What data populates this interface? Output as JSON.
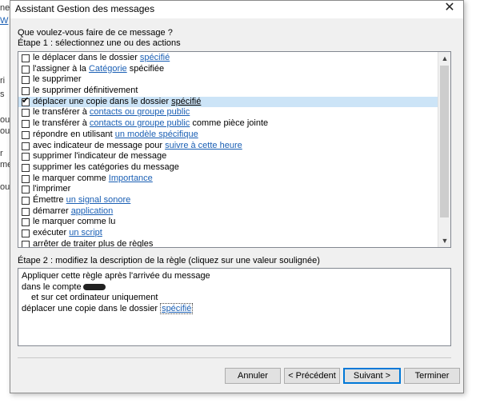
{
  "background": {
    "fragments": [
      "ne",
      "W",
      "ri",
      "s",
      "ou",
      "ou",
      "r",
      "me",
      "ou"
    ]
  },
  "dialog": {
    "title": "Assistant Gestion des messages",
    "question": "Que voulez-vous faire de ce message ?",
    "step1_label": "Étape 1 : sélectionnez une ou des actions",
    "actions": [
      {
        "pre": "le déplacer dans le dossier ",
        "link": "spécifié",
        "post": "",
        "checked": false,
        "selected": false
      },
      {
        "pre": "l'assigner à la ",
        "link": "Catégorie",
        "post": " spécifiée",
        "checked": false,
        "selected": false
      },
      {
        "pre": "le supprimer",
        "link": "",
        "post": "",
        "checked": false,
        "selected": false
      },
      {
        "pre": "le supprimer définitivement",
        "link": "",
        "post": "",
        "checked": false,
        "selected": false
      },
      {
        "pre": "déplacer une copie dans le dossier ",
        "link": "spécifié",
        "post": "",
        "checked": true,
        "selected": true
      },
      {
        "pre": "le transférer à ",
        "link": "contacts ou groupe public",
        "post": "",
        "checked": false,
        "selected": false
      },
      {
        "pre": "le transférer à ",
        "link": "contacts ou groupe public",
        "post": " comme pièce jointe",
        "checked": false,
        "selected": false
      },
      {
        "pre": "répondre en utilisant ",
        "link": "un modèle spécifique",
        "post": "",
        "checked": false,
        "selected": false
      },
      {
        "pre": "avec indicateur de message pour ",
        "link": "suivre à cette heure",
        "post": "",
        "checked": false,
        "selected": false
      },
      {
        "pre": "supprimer l'indicateur de message",
        "link": "",
        "post": "",
        "checked": false,
        "selected": false
      },
      {
        "pre": "supprimer les catégories du message",
        "link": "",
        "post": "",
        "checked": false,
        "selected": false
      },
      {
        "pre": "le marquer comme ",
        "link": "Importance",
        "post": "",
        "checked": false,
        "selected": false
      },
      {
        "pre": "l'imprimer",
        "link": "",
        "post": "",
        "checked": false,
        "selected": false
      },
      {
        "pre": "Émettre ",
        "link": "un signal sonore",
        "post": "",
        "checked": false,
        "selected": false
      },
      {
        "pre": "démarrer ",
        "link": "application",
        "post": "",
        "checked": false,
        "selected": false
      },
      {
        "pre": "le marquer comme lu",
        "link": "",
        "post": "",
        "checked": false,
        "selected": false
      },
      {
        "pre": "exécuter ",
        "link": "un script",
        "post": "",
        "checked": false,
        "selected": false
      },
      {
        "pre": "arrêter de traiter plus de règles",
        "link": "",
        "post": "",
        "checked": false,
        "selected": false
      }
    ],
    "step2_label": "Étape 2 : modifiez la description de la règle (cliquez sur une valeur soulignée)",
    "description": {
      "line1": "Appliquer cette règle après l'arrivée du message",
      "line2": "dans le compte",
      "line3": "et sur cet ordinateur uniquement",
      "line4_pre": "déplacer une copie dans le dossier ",
      "line4_link": "spécifié"
    },
    "buttons": {
      "cancel": "Annuler",
      "previous": "< Précédent",
      "next": "Suivant >",
      "finish": "Terminer"
    }
  }
}
